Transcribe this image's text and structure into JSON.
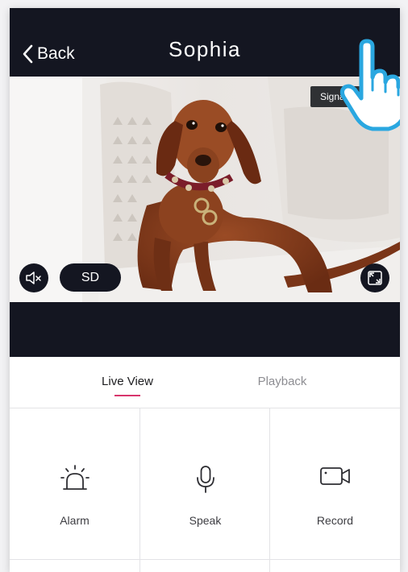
{
  "header": {
    "back_label": "Back",
    "title": "Sophia"
  },
  "video": {
    "quality_label": "SD",
    "signal_tooltip": "Signal",
    "muted": true
  },
  "tabs": [
    {
      "label": "Live View",
      "active": true
    },
    {
      "label": "Playback",
      "active": false
    }
  ],
  "actions": [
    {
      "label": "Alarm",
      "icon": "alarm-siren-icon"
    },
    {
      "label": "Speak",
      "icon": "microphone-icon"
    },
    {
      "label": "Record",
      "icon": "video-camera-icon"
    }
  ],
  "colors": {
    "header_bg": "#141621",
    "accent": "#d8356c",
    "pointer_hand_outline": "#2aa7e0"
  }
}
